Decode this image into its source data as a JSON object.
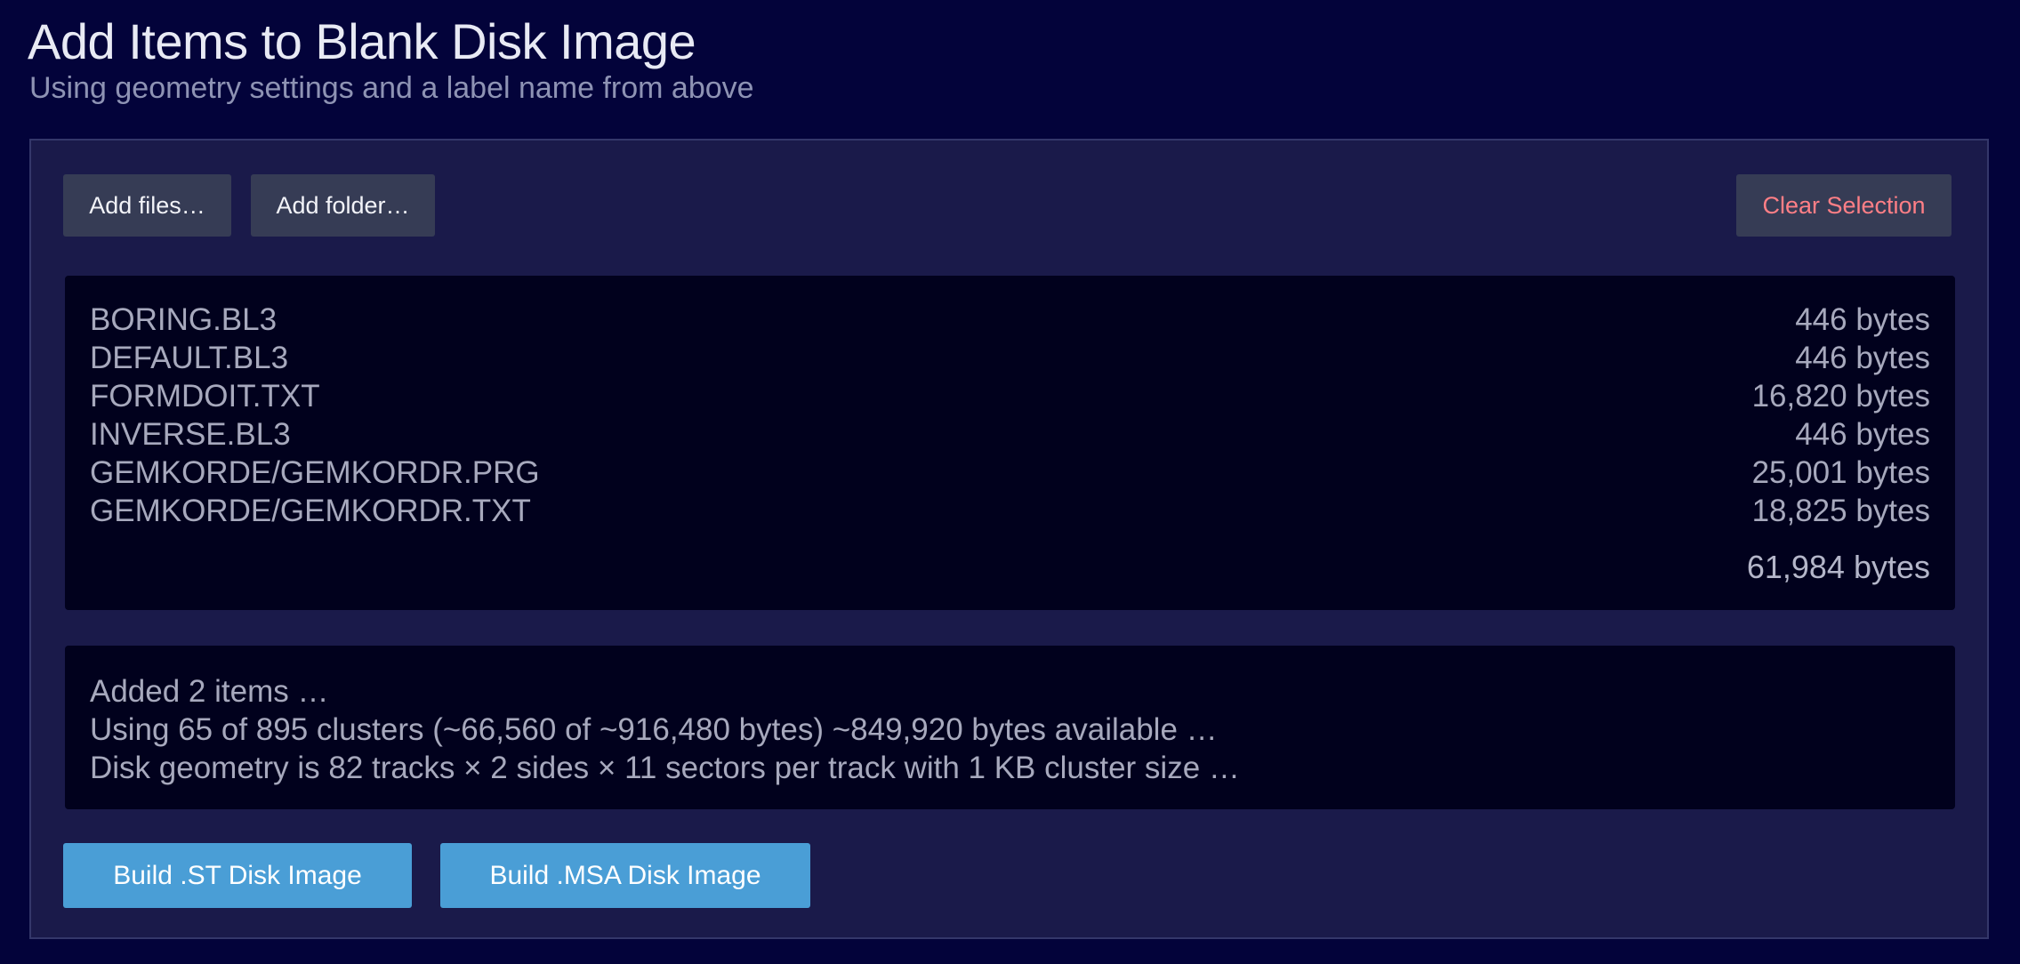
{
  "header": {
    "title": "Add Items to Blank Disk Image",
    "subtitle": "Using geometry settings and a label name from above"
  },
  "toolbar": {
    "add_files_label": "Add files…",
    "add_folder_label": "Add folder…",
    "clear_selection_label": "Clear Selection"
  },
  "files": [
    {
      "name": "BORING.BL3",
      "size": "446 bytes"
    },
    {
      "name": "DEFAULT.BL3",
      "size": "446 bytes"
    },
    {
      "name": "FORMDOIT.TXT",
      "size": "16,820 bytes"
    },
    {
      "name": "INVERSE.BL3",
      "size": "446 bytes"
    },
    {
      "name": "GEMKORDE/GEMKORDR.PRG",
      "size": "25,001 bytes"
    },
    {
      "name": "GEMKORDE/GEMKORDR.TXT",
      "size": "18,825 bytes"
    }
  ],
  "total_size": "61,984 bytes",
  "status": [
    "Added 2 items …",
    "Using 65 of 895 clusters (~66,560 of ~916,480 bytes) ~849,920 bytes available …",
    "Disk geometry is 82 tracks × 2 sides × 11 sectors per track with 1 KB cluster size …"
  ],
  "actions": {
    "build_st_label": "Build .ST Disk Image",
    "build_msa_label": "Build .MSA Disk Image"
  },
  "colors": {
    "background": "#03033a",
    "panel": "#1a1a4a",
    "primary_button": "#4a9ed6",
    "secondary_button": "#363c55",
    "danger_text": "#ff7f86"
  }
}
